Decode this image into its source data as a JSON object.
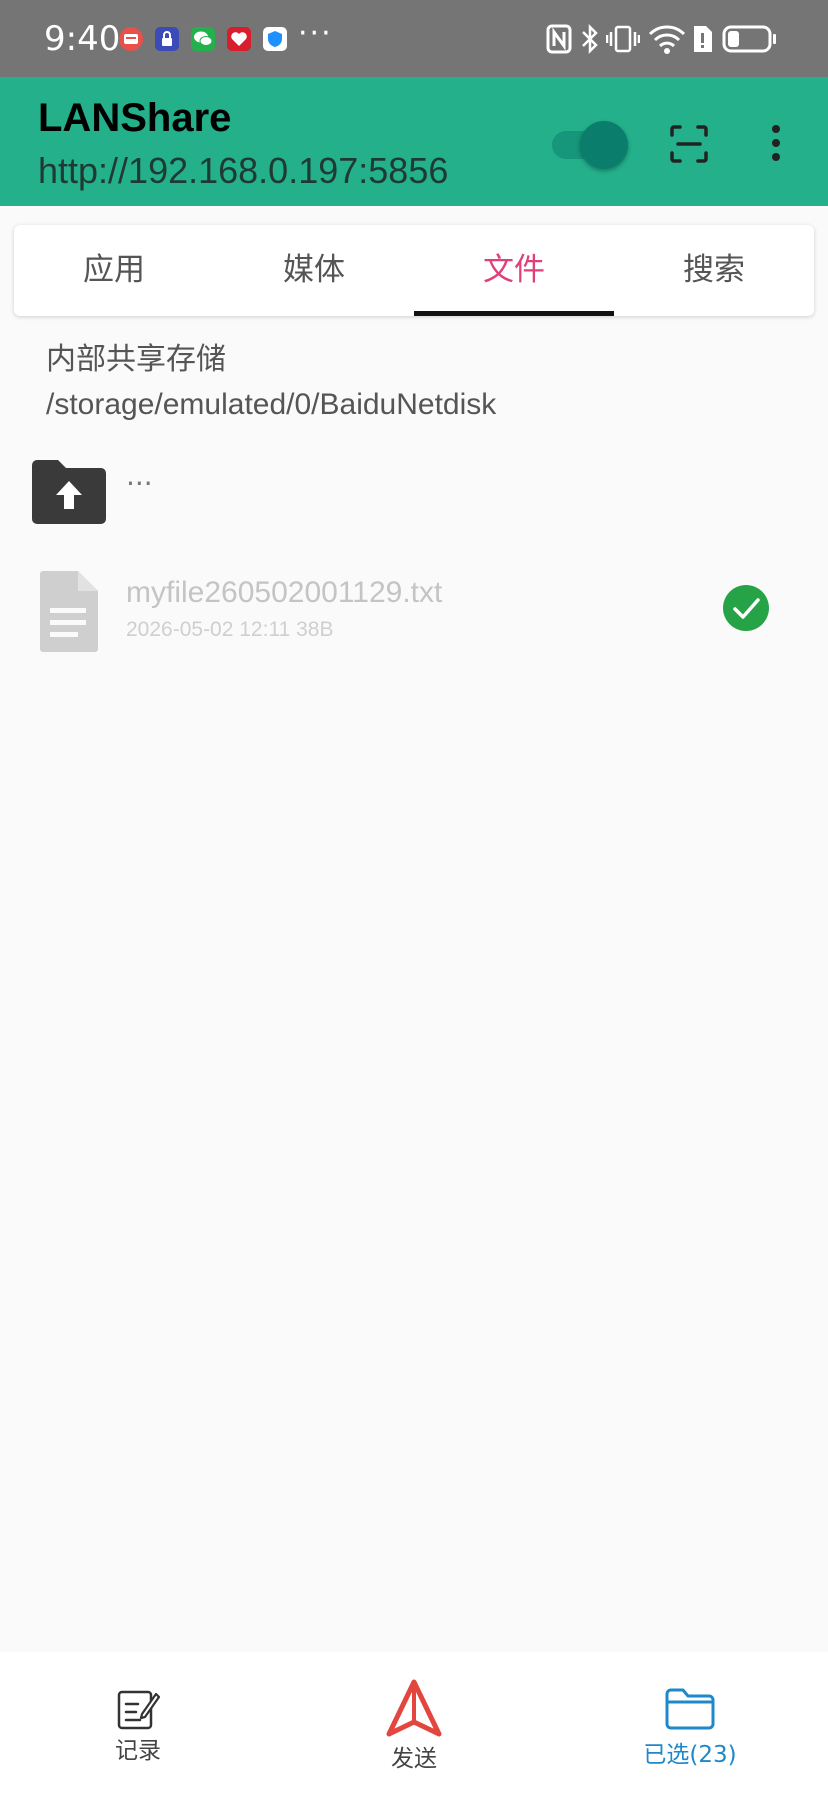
{
  "status_bar": {
    "time": "9:40",
    "more": "···",
    "notification_icons": [
      "card-app-icon",
      "lock-app-icon",
      "wechat-icon",
      "health-app-icon",
      "shield-app-icon"
    ],
    "system_icons": [
      "nfc-icon",
      "bluetooth-icon",
      "vibrate-icon",
      "wifi-icon",
      "sim-alert-icon",
      "battery-icon"
    ],
    "battery_level": 0.3
  },
  "app_bar": {
    "title": "LANShare",
    "url": "http://192.168.0.197:5856",
    "toggle_on": true
  },
  "tabs": [
    {
      "label": "应用",
      "active": false
    },
    {
      "label": "媒体",
      "active": false
    },
    {
      "label": "文件",
      "active": true
    },
    {
      "label": "搜索",
      "active": false
    }
  ],
  "browser": {
    "storage_name": "内部共享存储",
    "path": "/storage/emulated/0/BaiduNetdisk",
    "up_label": "...",
    "files": [
      {
        "name": "myfile260502001129.txt",
        "meta": "2026-05-02 12:11 38B",
        "selected": true
      }
    ]
  },
  "bottom_nav": {
    "history_label": "记录",
    "send_label": "发送",
    "selected_label": "已选(23)"
  },
  "colors": {
    "status_bar": "#757575",
    "app_bar": "#23b08b",
    "active_tab": "#e0407a",
    "send_icon": "#e2463f",
    "selected_nav": "#1e88c8",
    "check": "#26a346"
  }
}
